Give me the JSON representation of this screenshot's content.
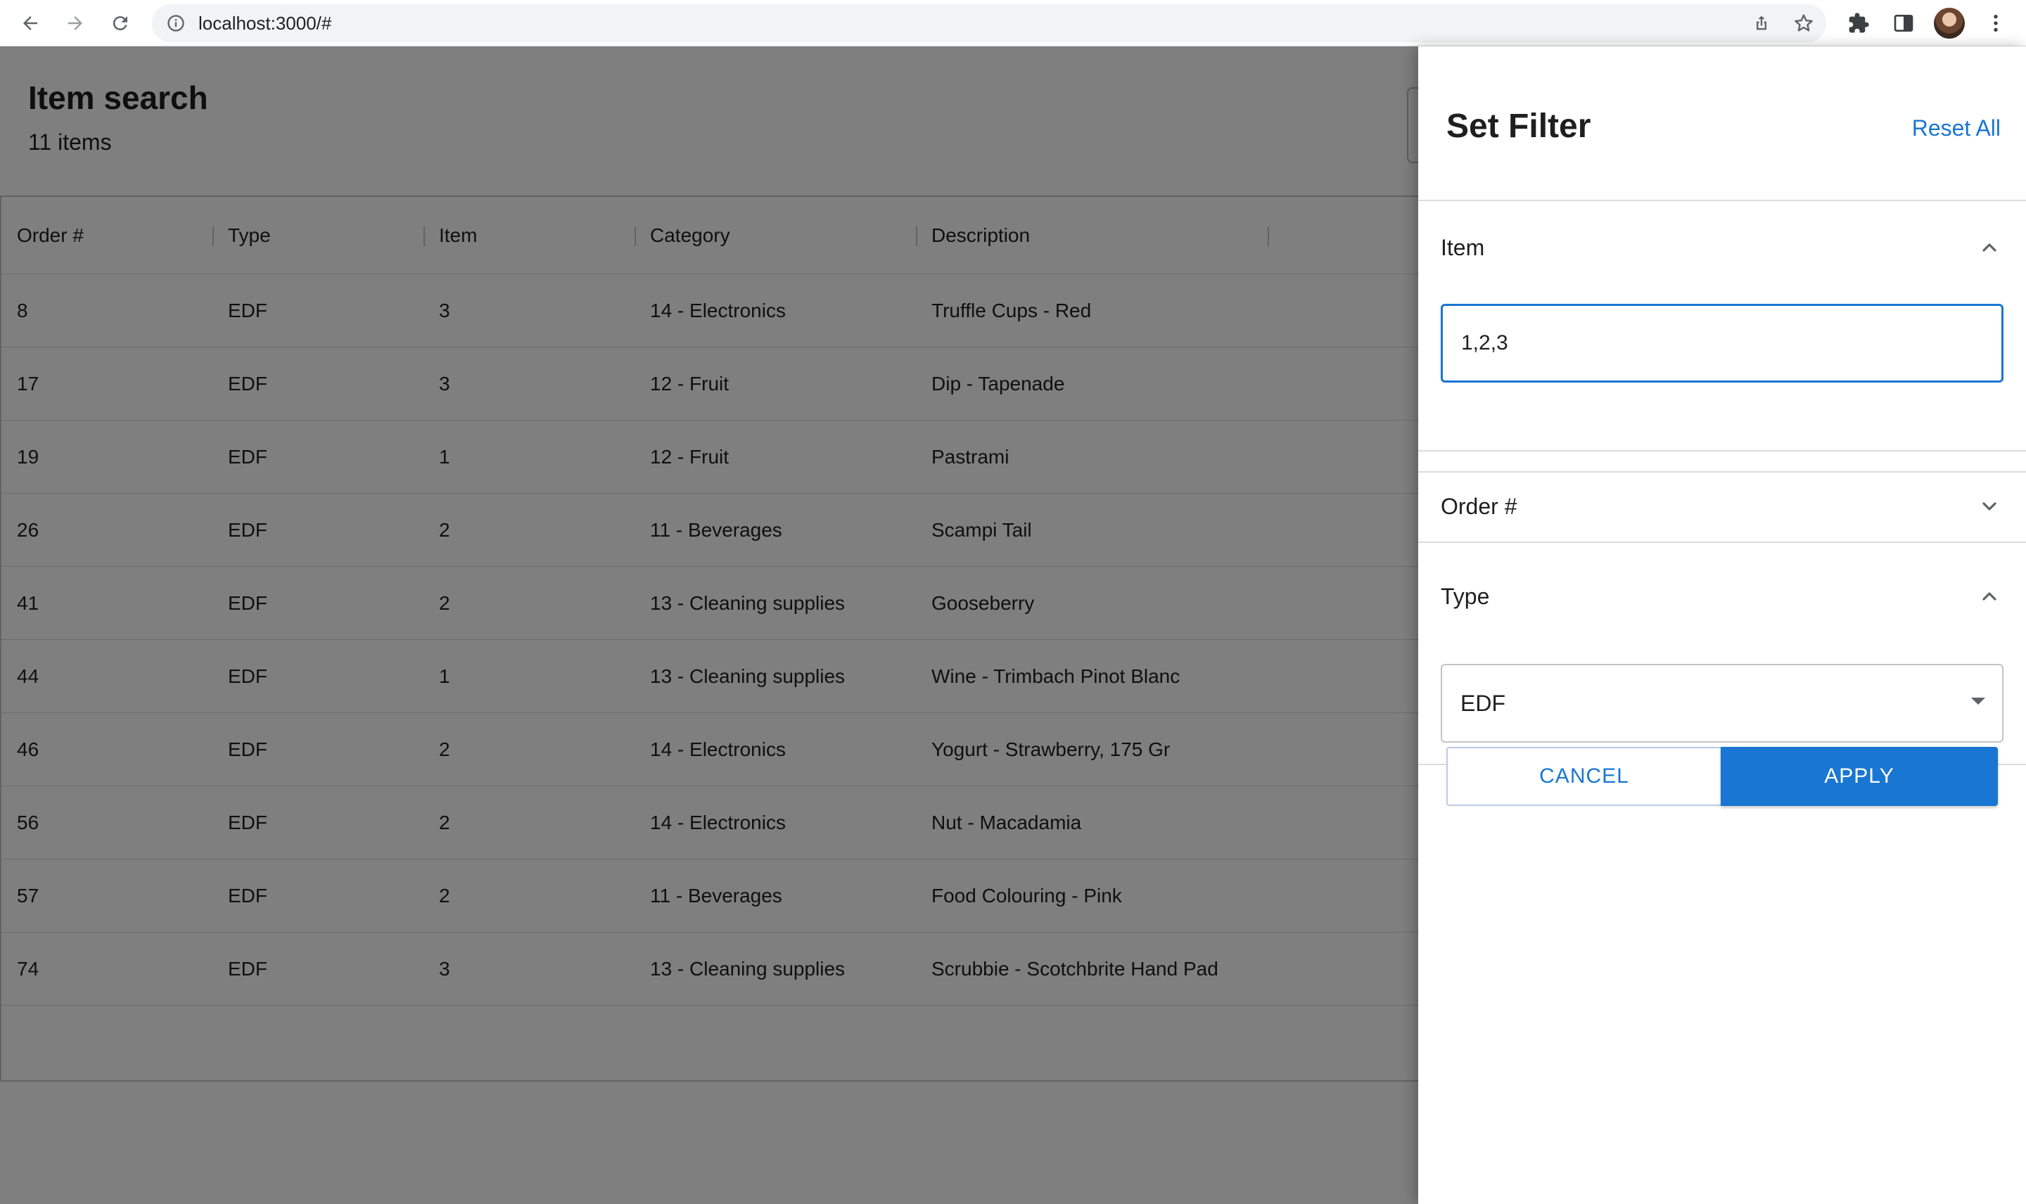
{
  "browser": {
    "url": "localhost:3000/#",
    "icons": [
      "back-arrow-icon",
      "forward-arrow-icon",
      "reload-icon",
      "info-icon",
      "share-icon",
      "star-icon",
      "puzzle-icon",
      "side-panel-icon",
      "avatar",
      "kebab-menu-icon"
    ]
  },
  "page": {
    "title": "Item search",
    "count": "11 items"
  },
  "grid": {
    "columns": [
      "Order #",
      "Type",
      "Item",
      "Category",
      "Description"
    ],
    "rows": [
      [
        "8",
        "EDF",
        "3",
        "14 - Electronics",
        "Truffle Cups - Red"
      ],
      [
        "17",
        "EDF",
        "3",
        "12 - Fruit",
        "Dip - Tapenade"
      ],
      [
        "19",
        "EDF",
        "1",
        "12 - Fruit",
        "Pastrami"
      ],
      [
        "26",
        "EDF",
        "2",
        "11 - Beverages",
        "Scampi Tail"
      ],
      [
        "41",
        "EDF",
        "2",
        "13 - Cleaning supplies",
        "Gooseberry"
      ],
      [
        "44",
        "EDF",
        "1",
        "13 - Cleaning supplies",
        "Wine - Trimbach Pinot Blanc"
      ],
      [
        "46",
        "EDF",
        "2",
        "14 - Electronics",
        "Yogurt - Strawberry, 175 Gr"
      ],
      [
        "56",
        "EDF",
        "2",
        "14 - Electronics",
        "Nut - Macadamia"
      ],
      [
        "57",
        "EDF",
        "2",
        "11 - Beverages",
        "Food Colouring - Pink"
      ],
      [
        "74",
        "EDF",
        "3",
        "13 - Cleaning supplies",
        "Scrubbie - Scotchbrite Hand Pad"
      ]
    ]
  },
  "drawer": {
    "title": "Set Filter",
    "reset_label": "Reset All",
    "sections": {
      "item": {
        "label": "Item",
        "expanded": true,
        "value": "1,2,3"
      },
      "order": {
        "label": "Order #",
        "expanded": false
      },
      "type": {
        "label": "Type",
        "expanded": true,
        "selected": "EDF"
      }
    },
    "cancel_label": "CANCEL",
    "apply_label": "APPLY"
  },
  "colors": {
    "accent": "#1976d2",
    "overlay": "rgba(0,0,0,0.5)"
  }
}
